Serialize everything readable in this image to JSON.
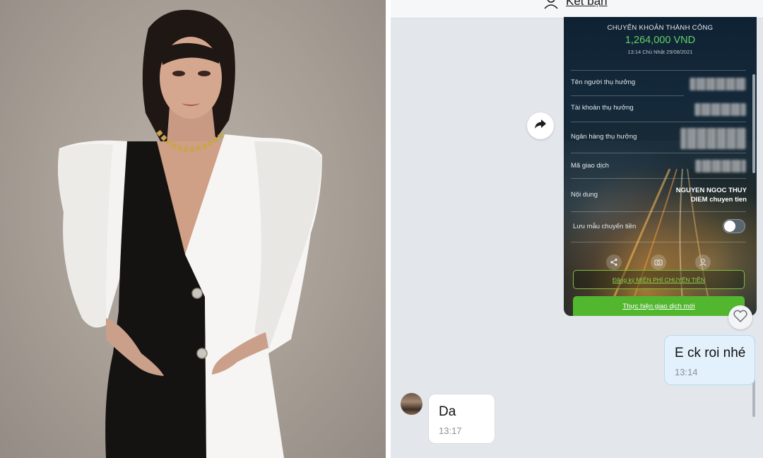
{
  "chat": {
    "header": {
      "add_friend_label": "Kết bạn"
    },
    "receipt": {
      "title": "CHUYỂN KHOẢN THÀNH CÔNG",
      "amount": "1,264,000 VND",
      "datetime": "13:14 Chủ Nhật 29/08/2021",
      "rows": [
        {
          "label": "Tên người thụ hưởng"
        },
        {
          "label": "Tài khoản thụ hưởng"
        },
        {
          "label": "Ngân hàng thụ hưởng"
        },
        {
          "label": "Mã giao dịch"
        },
        {
          "label": "Nội dung",
          "value_line1": "NGUYEN NGOC THUY",
          "value_line2": "DIEM chuyen tien"
        }
      ],
      "save_template_label": "Lưu mẫu chuyển tiền",
      "save_template_enabled": false,
      "register_button": "Đăng ký MIỄN PHÍ CHUYỂN TIỀN",
      "new_transaction_button": "Thực hiện giao dịch mới"
    },
    "messages": [
      {
        "direction": "outgoing",
        "text": "E ck roi nhé",
        "time": "13:14"
      },
      {
        "direction": "incoming",
        "text": "Da",
        "time": "13:17"
      }
    ],
    "colors": {
      "outgoing_bubble": "#e2f1fc",
      "incoming_bubble": "#ffffff",
      "chat_background": "#e3e7ec",
      "amount_green": "#63d067",
      "button_green": "#52b72f"
    },
    "icons": [
      "person-icon",
      "forward-icon",
      "heart-icon",
      "share-icon",
      "camera-icon",
      "user-icon"
    ]
  }
}
